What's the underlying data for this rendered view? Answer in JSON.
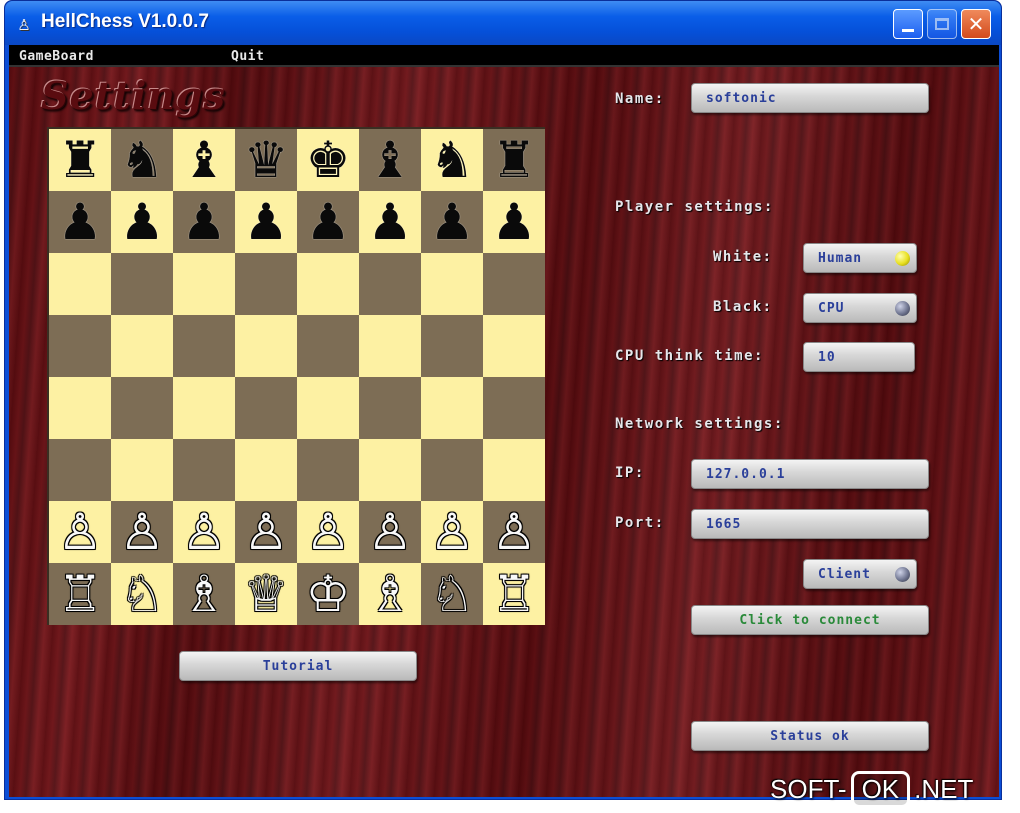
{
  "window": {
    "title": "HellChess V1.0.0.7",
    "app_icon": "pawn-icon",
    "controls": {
      "minimize": "minimize-icon",
      "maximize": "maximize-icon",
      "close": "✕"
    }
  },
  "menu": [
    "GameBoard",
    "Quit"
  ],
  "heading": "Settings",
  "board": {
    "ranks": [
      [
        "♜",
        "♞",
        "♝",
        "♛",
        "♚",
        "♝",
        "♞",
        "♜"
      ],
      [
        "♟",
        "♟",
        "♟",
        "♟",
        "♟",
        "♟",
        "♟",
        "♟"
      ],
      [
        "",
        "",
        "",
        "",
        "",
        "",
        "",
        ""
      ],
      [
        "",
        "",
        "",
        "",
        "",
        "",
        "",
        ""
      ],
      [
        "",
        "",
        "",
        "",
        "",
        "",
        "",
        ""
      ],
      [
        "",
        "",
        "",
        "",
        "",
        "",
        "",
        ""
      ],
      [
        "♙",
        "♙",
        "♙",
        "♙",
        "♙",
        "♙",
        "♙",
        "♙"
      ],
      [
        "♖",
        "♘",
        "♗",
        "♕",
        "♔",
        "♗",
        "♘",
        "♖"
      ]
    ],
    "light_color": "#fdf1a3",
    "dark_color": "#7d6d55"
  },
  "tutorial_button": "Tutorial",
  "settings": {
    "name_label": "Name:",
    "name_value": "softonic",
    "player_settings_heading": "Player settings:",
    "white_label": "White:",
    "white_value": "Human",
    "black_label": "Black:",
    "black_value": "CPU",
    "cpu_time_label": "CPU think time:",
    "cpu_time_value": "10",
    "network_heading": "Network settings:",
    "ip_label": "IP:",
    "ip_value": "127.0.0.1",
    "port_label": "Port:",
    "port_value": "1665",
    "mode_value": "Client",
    "connect_button": "Click to connect",
    "status_button": "Status ok"
  },
  "watermark": {
    "left": "SOFT-",
    "box": "OK",
    "right": ".NET"
  }
}
